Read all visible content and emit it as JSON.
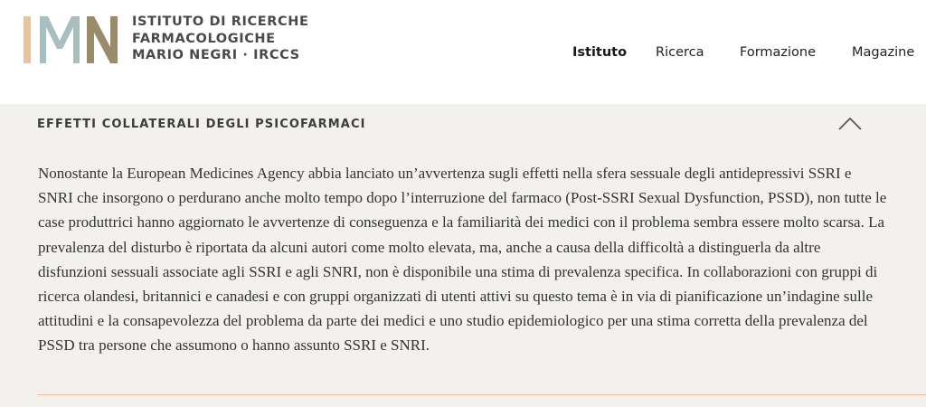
{
  "brand": {
    "name_lines": [
      "ISTITUTO DI RICERCHE",
      "FARMACOLOGICHE",
      "MARIO NEGRI · IRCCS"
    ],
    "logo_letters": "IMN",
    "colors": {
      "bar_i": "#e8c39f",
      "letter_m": "#a9bec0",
      "letter_n": "#9a8c6a"
    }
  },
  "nav": {
    "items": [
      {
        "label": "Istituto",
        "active": true
      },
      {
        "label": "Ricerca"
      },
      {
        "label": "Formazione"
      },
      {
        "label": "Magazine"
      }
    ]
  },
  "section": {
    "title": "EFFETTI COLLATERALI DEGLI PSICOFARMACI",
    "expanded": true,
    "toggle_icon": "chevron-up-icon",
    "body": "Nonostante la European Medicines Agency abbia lanciato un’avvertenza sugli effetti nella sfera sessuale degli antidepressivi SSRI e SNRI che insorgono o perdurano anche molto tempo dopo l’interruzione del farmaco (Post-SSRI Sexual Dysfunction, PSSD), non tutte le case produttrici hanno aggiornato le avvertenze di conseguenza e la familiarità dei medici con il problema sembra essere molto scarsa. La prevalenza del disturbo è riportata da alcuni autori come molto elevata, ma, anche a causa della difficoltà a distinguerla da altre disfunzioni sessuali associate agli SSRI e agli SNRI, non è disponibile una stima di prevalenza specifica. In collaborazioni con gruppi di ricerca olandesi, britannici e canadesi e con gruppi organizzati di utenti attivi su questo tema è in via di pianificazione un’indagine sulle attitudini e la consapevolezza del problema da parte dei medici e uno studio epidemiologico per una stima corretta della prevalenza del PSSD tra persone che assumono o hanno assunto SSRI e SNRI."
  },
  "theme": {
    "background": "#f3f1ee",
    "divider": "#f0b9a4"
  }
}
